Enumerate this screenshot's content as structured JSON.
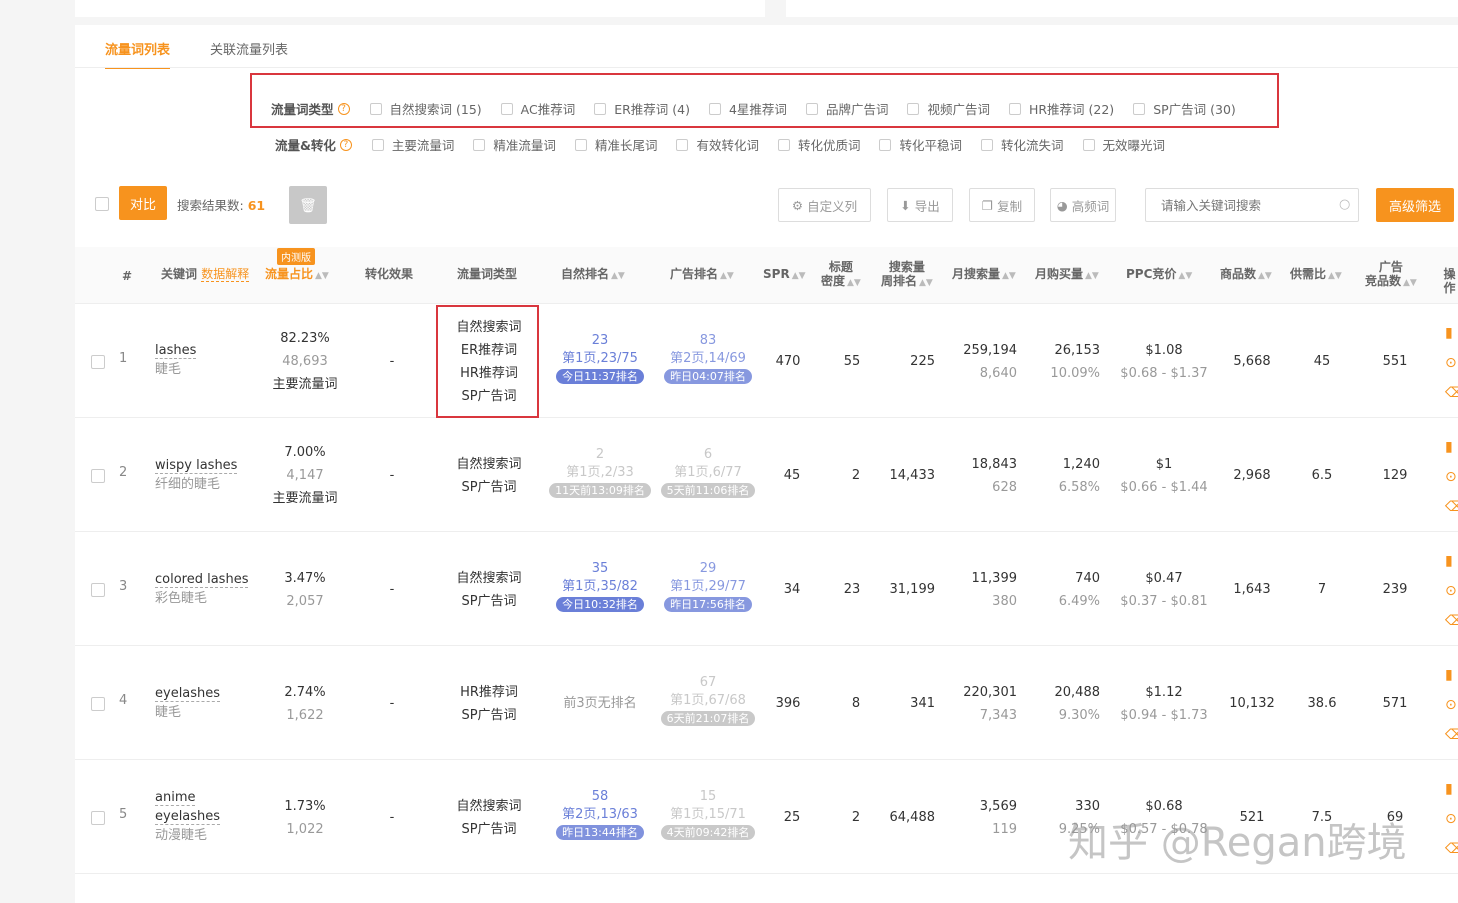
{
  "tabs": [
    "流量词列表",
    "关联流量列表"
  ],
  "filter_type": {
    "label": "流量词类型",
    "options": [
      "自然搜索词 (15)",
      "AC推荐词",
      "ER推荐词 (4)",
      "4星推荐词",
      "品牌广告词",
      "视频广告词",
      "HR推荐词 (22)",
      "SP广告词 (30)"
    ]
  },
  "filter_conv": {
    "label": "流量&转化",
    "options": [
      "主要流量词",
      "精准流量词",
      "精准长尾词",
      "有效转化词",
      "转化优质词",
      "转化平稳词",
      "转化流失词",
      "无效曝光词"
    ]
  },
  "toolbar": {
    "compare": "对比",
    "result_label": "搜索结果数:",
    "result_count": "61",
    "custom_cols": "自定义列",
    "export": "导出",
    "copy": "复制",
    "high_freq": "高频词",
    "search_placeholder": "请输入关键词搜索",
    "advanced": "高级筛选"
  },
  "headers": {
    "idx": "#",
    "keyword": "关键词",
    "explain": "数据解释",
    "beta": "内测版",
    "share": "流量占比",
    "conv": "转化效果",
    "type": "流量词类型",
    "natural_rank": "自然排名",
    "ad_rank": "广告排名",
    "spr": "SPR",
    "title_density": "标题\n密度",
    "search_week_rank": "搜索量\n周排名",
    "monthly_search": "月搜索量",
    "monthly_buy": "月购买量",
    "ppc": "PPC竞价",
    "products": "商品数",
    "supply_demand": "供需比",
    "ad_products": "广告\n竞品数",
    "ops": "操作"
  },
  "rows": [
    {
      "idx": "1",
      "kw_en": "lashes",
      "kw_cn": "睫毛",
      "share": "82.23%",
      "share_num": "48,693",
      "share_tag": "主要流量词",
      "conv": "-",
      "types": [
        "自然搜索词",
        "ER推荐词",
        "HR推荐词",
        "SP广告词"
      ],
      "nat_rank": "23",
      "nat_page": "第1页,23/75",
      "nat_time": "今日11:37排名",
      "ad_rank": "83",
      "ad_page": "第2页,14/69",
      "ad_time": "昨日04:07排名",
      "spr": "470",
      "density": "55",
      "week_rank": "225",
      "m_search": "259,194",
      "m_search_sub": "8,640",
      "m_buy": "26,153",
      "m_buy_sub": "10.09%",
      "ppc": "$1.08",
      "ppc_range": "$0.68 - $1.37",
      "products": "5,668",
      "sd": "45",
      "ad_products": "551"
    },
    {
      "idx": "2",
      "kw_en": "wispy lashes",
      "kw_cn": "纤细的睫毛",
      "share": "7.00%",
      "share_num": "4,147",
      "share_tag": "主要流量词",
      "conv": "-",
      "types": [
        "自然搜索词",
        "SP广告词"
      ],
      "nat_rank": "2",
      "nat_page": "第1页,2/33",
      "nat_time": "11天前13:09排名",
      "ad_rank": "6",
      "ad_page": "第1页,6/77",
      "ad_time": "5天前11:06排名",
      "spr": "45",
      "density": "2",
      "week_rank": "14,433",
      "m_search": "18,843",
      "m_search_sub": "628",
      "m_buy": "1,240",
      "m_buy_sub": "6.58%",
      "ppc": "$1",
      "ppc_range": "$0.66 - $1.44",
      "products": "2,968",
      "sd": "6.5",
      "ad_products": "129"
    },
    {
      "idx": "3",
      "kw_en": "colored lashes",
      "kw_cn": "彩色睫毛",
      "share": "3.47%",
      "share_num": "2,057",
      "share_tag": "",
      "conv": "-",
      "types": [
        "自然搜索词",
        "SP广告词"
      ],
      "nat_rank": "35",
      "nat_page": "第1页,35/82",
      "nat_time": "今日10:32排名",
      "ad_rank": "29",
      "ad_page": "第1页,29/77",
      "ad_time": "昨日17:56排名",
      "spr": "34",
      "density": "23",
      "week_rank": "31,199",
      "m_search": "11,399",
      "m_search_sub": "380",
      "m_buy": "740",
      "m_buy_sub": "6.49%",
      "ppc": "$0.47",
      "ppc_range": "$0.37 - $0.81",
      "products": "1,643",
      "sd": "7",
      "ad_products": "239"
    },
    {
      "idx": "4",
      "kw_en": "eyelashes",
      "kw_cn": "睫毛",
      "share": "2.74%",
      "share_num": "1,622",
      "share_tag": "",
      "conv": "-",
      "types": [
        "HR推荐词",
        "SP广告词"
      ],
      "nat_none": "前3页无排名",
      "ad_rank": "67",
      "ad_page": "第1页,67/68",
      "ad_time": "6天前21:07排名",
      "spr": "396",
      "density": "8",
      "week_rank": "341",
      "m_search": "220,301",
      "m_search_sub": "7,343",
      "m_buy": "20,488",
      "m_buy_sub": "9.30%",
      "ppc": "$1.12",
      "ppc_range": "$0.94 - $1.73",
      "products": "10,132",
      "sd": "38.6",
      "ad_products": "571"
    },
    {
      "idx": "5",
      "kw_en": "anime",
      "kw_en2": "eyelashes",
      "kw_cn": "动漫睫毛",
      "share": "1.73%",
      "share_num": "1,022",
      "share_tag": "",
      "conv": "-",
      "types": [
        "自然搜索词",
        "SP广告词"
      ],
      "nat_rank": "58",
      "nat_page": "第2页,13/63",
      "nat_time": "昨日13:44排名",
      "ad_rank": "15",
      "ad_page": "第1页,15/71",
      "ad_time": "4天前09:42排名",
      "spr": "25",
      "density": "2",
      "week_rank": "64,488",
      "m_search": "3,569",
      "m_search_sub": "119",
      "m_buy": "330",
      "m_buy_sub": "9.25%",
      "ppc": "$0.68",
      "ppc_range": "$0.57 - $0.78",
      "products": "521",
      "sd": "7.5",
      "ad_products": "69"
    }
  ],
  "watermark": "知乎 @Regan跨境",
  "colors": {
    "accent": "#f7931e",
    "blue": "#6a7fd8",
    "highlight": "#d9363e"
  }
}
